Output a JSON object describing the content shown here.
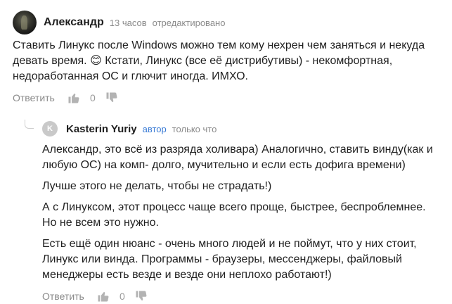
{
  "comment": {
    "author": "Александр",
    "time": "13 часов",
    "edited": "отредактировано",
    "text": "Ставить Линукс после Windows можно тем кому нехрен чем заняться и некуда девать время. 😊 Кстати, Линукс (все её дистрибутивы) - некомфортная, недоработанная ОС и глючит иногда. ИМХО.",
    "reply_label": "Ответить",
    "likes": "0",
    "dislikes": ""
  },
  "reply": {
    "avatar_letter": "K",
    "author": "Kasterin Yuriy",
    "badge": "автор",
    "time": "только что",
    "paragraphs": [
      "Александр, это всё из разряда холивара) Аналогично, ставить винду(как и любую ОС) на комп- долго, мучительно и если есть дофига времени)",
      "Лучше этого не делать, чтобы не страдать!)",
      "А с Линуксом, этот процесс чаще всего проще, быстрее, беспроблемнее. Но не всем это нужно.",
      "Есть ещё один нюанс - очень много людей и не поймут, что у них стоит, Линукс или винда. Программы - браузеры, мессенджеры, файловый менеджеры есть везде и везде они неплохо работают!)"
    ],
    "reply_label": "Ответить",
    "likes": "0"
  },
  "icons": {
    "like": "thumbs-up-icon",
    "dislike": "thumbs-down-icon"
  },
  "colors": {
    "text": "#1f1f1f",
    "muted": "#8a8a8a",
    "author_badge": "#3a7bd5",
    "avatar_letter_bg": "#c9c9c9"
  }
}
